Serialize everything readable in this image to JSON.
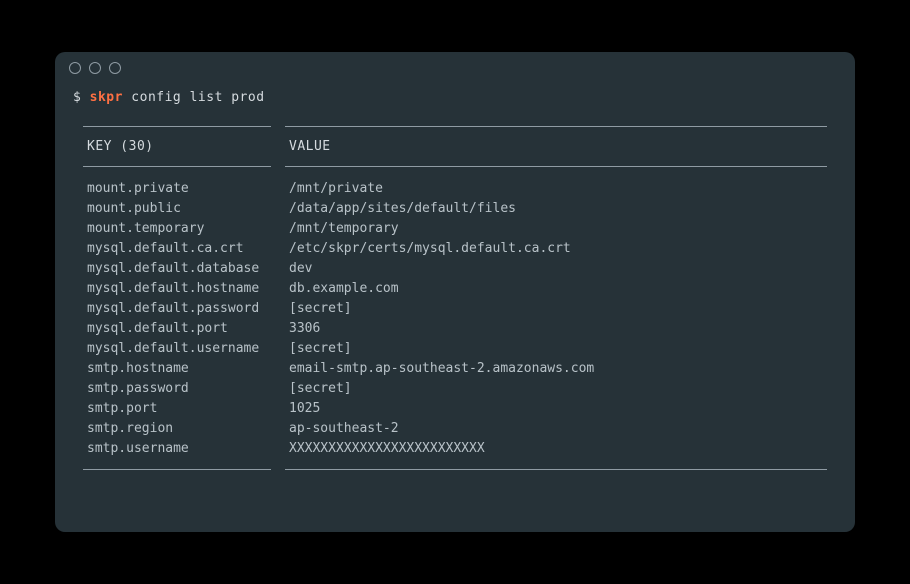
{
  "prompt": {
    "symbol": "$",
    "command": "skpr",
    "args": "config list prod"
  },
  "table": {
    "headers": {
      "key": "KEY (30)",
      "value": "VALUE"
    },
    "rows": [
      {
        "key": "mount.private",
        "value": "/mnt/private"
      },
      {
        "key": "mount.public",
        "value": "/data/app/sites/default/files"
      },
      {
        "key": "mount.temporary",
        "value": "/mnt/temporary"
      },
      {
        "key": "mysql.default.ca.crt",
        "value": "/etc/skpr/certs/mysql.default.ca.crt"
      },
      {
        "key": "mysql.default.database",
        "value": "dev"
      },
      {
        "key": "mysql.default.hostname",
        "value": "db.example.com"
      },
      {
        "key": "mysql.default.password",
        "value": "[secret]"
      },
      {
        "key": "mysql.default.port",
        "value": "3306"
      },
      {
        "key": "mysql.default.username",
        "value": "[secret]"
      },
      {
        "key": "smtp.hostname",
        "value": "email-smtp.ap-southeast-2.amazonaws.com"
      },
      {
        "key": "smtp.password",
        "value": "[secret]"
      },
      {
        "key": "smtp.port",
        "value": "1025"
      },
      {
        "key": "smtp.region",
        "value": "ap-southeast-2"
      },
      {
        "key": "smtp.username",
        "value": "XXXXXXXXXXXXXXXXXXXXXXXXX"
      }
    ]
  }
}
